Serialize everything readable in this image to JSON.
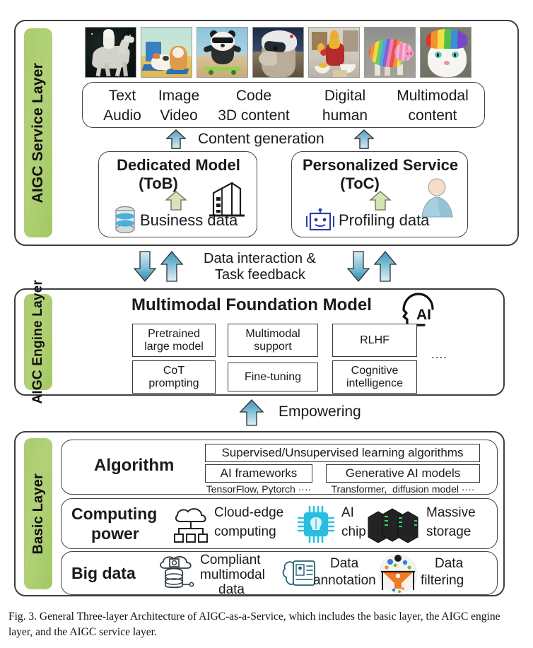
{
  "figure": {
    "caption": "Fig. 3.  General Three-layer Architecture of AIGC-as-a-Service, which includes the basic layer, the AIGC engine layer, and the AIGC service layer.",
    "accent_green": "#a9cd6e",
    "accent_blue": "#4e9fc0",
    "arrow_green": "#cfdfae",
    "border_dark": "#3d3d3d"
  },
  "service_layer": {
    "tab_label": "AIGC Service Layer",
    "thumbnails": [
      "astronaut-riding-horse-thumbnail",
      "cat-and-corgi-at-desk-thumbnail",
      "panda-on-skateboard-thumbnail",
      "raccoon-in-helmet-thumbnail",
      "ironman-cooking-thumbnail",
      "rainbow-striped-pig-thumbnail",
      "rainbow-hair-cat-thumbnail"
    ],
    "output_types": {
      "row1": [
        "Text",
        "Image",
        "Code",
        "Digital",
        "Multimodal"
      ],
      "row2": [
        "Audio",
        "Video",
        "3D content",
        "human",
        "content"
      ]
    },
    "content_generation_label": "Content generation",
    "cards": [
      {
        "title_line1": "Dedicated Model",
        "title_line2": "(ToB)",
        "data_label": "Business data",
        "data_icon": "database-icon",
        "entity_icon": "office-building-icon"
      },
      {
        "title_line1": "Personalized Service",
        "title_line2": "(ToC)",
        "data_label": "Profiling data",
        "data_icon": "robot-icon",
        "entity_icon": "user-person-icon"
      }
    ]
  },
  "interaction": {
    "label_line1": "Data interaction &",
    "label_line2": "Task feedback"
  },
  "engine_layer": {
    "tab_label": "AIGC Engine Layer",
    "title": "Multimodal Foundation Model",
    "title_icon": "ai-head-icon",
    "title_icon_text": "AI",
    "capabilities_row1": [
      "Pretrained\nlarge model",
      "Multimodal\nsupport",
      "RLHF"
    ],
    "capabilities_row2": [
      "CoT\nprompting",
      "Fine-tuning",
      "Cognitive\nintelligence"
    ],
    "ellipsis": "...."
  },
  "empowering": {
    "label": "Empowering"
  },
  "basic_layer": {
    "tab_label": "Basic Layer",
    "rows": [
      {
        "title": "Algorithm",
        "chips": [
          {
            "label": "Supervised/Unsupervised learning algorithms"
          },
          {
            "label": "AI frameworks",
            "sub": "TensorFlow, Pytorch ····"
          },
          {
            "label": "Generative AI models",
            "sub": "Transformer,  diffusion model ····"
          }
        ]
      },
      {
        "title_line1": "Computing",
        "title_line2": "power",
        "items": [
          {
            "icon": "cloud-edge-icon",
            "label_line1": "Cloud-edge",
            "label_line2": "computing"
          },
          {
            "icon": "ai-chip-icon",
            "label_line1": "AI",
            "label_line2": "chip"
          },
          {
            "icon": "server-storage-icon",
            "label_line1": "Massive",
            "label_line2": "storage"
          }
        ]
      },
      {
        "title": "Big data",
        "items": [
          {
            "icon": "cloud-database-icon",
            "label_line1": "Compliant",
            "label_line2": "multimodal",
            "label_line3": "data"
          },
          {
            "icon": "annotation-brain-icon",
            "label_line1": "Data",
            "label_line2": "annotation"
          },
          {
            "icon": "funnel-filter-icon",
            "label_line1": "Data",
            "label_line2": "filtering"
          }
        ]
      }
    ]
  }
}
